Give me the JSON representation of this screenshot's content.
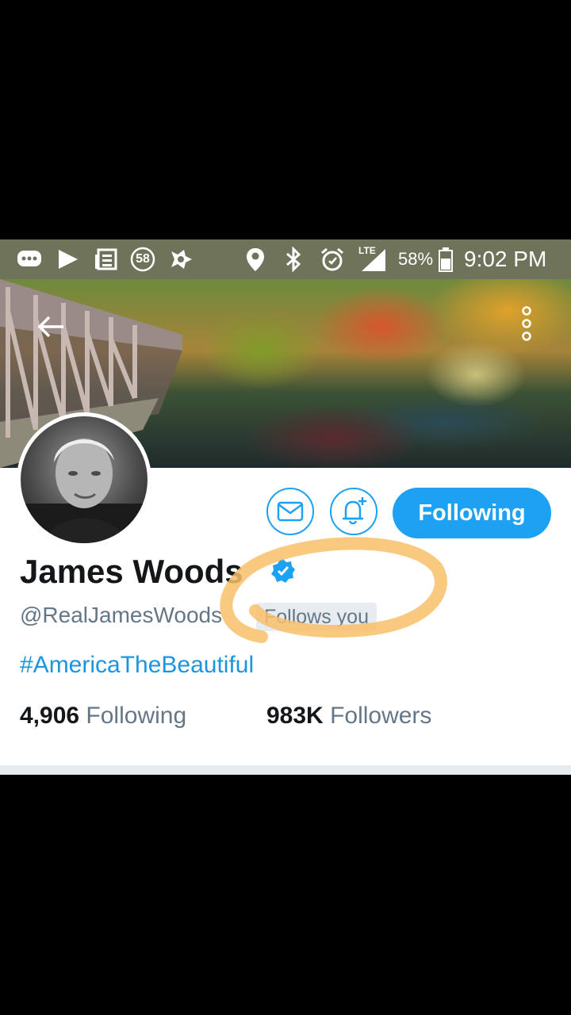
{
  "status_bar": {
    "notification_count": "58",
    "network": "LTE",
    "battery": "58%",
    "time": "9:02 PM",
    "icons": [
      "messages-icon",
      "play-store-icon",
      "news-icon",
      "notification-count-icon",
      "app-icon",
      "location-icon",
      "bluetooth-icon",
      "alarm-icon",
      "signal-icon",
      "battery-icon"
    ]
  },
  "header": {
    "back_icon": "back-arrow-icon",
    "menu_icon": "more-vertical-icon"
  },
  "profile": {
    "name": "James Woods",
    "handle": "@RealJamesWoods",
    "follows_you": "Follows you",
    "bio": "#AmericaTheBeautiful",
    "following_count": "4,906",
    "following_label": "Following",
    "followers_count": "983K",
    "followers_label": "Followers",
    "verified": true
  },
  "actions": {
    "message_icon": "envelope-icon",
    "notify_icon": "bell-plus-icon",
    "following_button": "Following"
  },
  "colors": {
    "accent": "#1da1f2",
    "status_bar": "#6f7359",
    "highlight": "#f9bf6a"
  }
}
